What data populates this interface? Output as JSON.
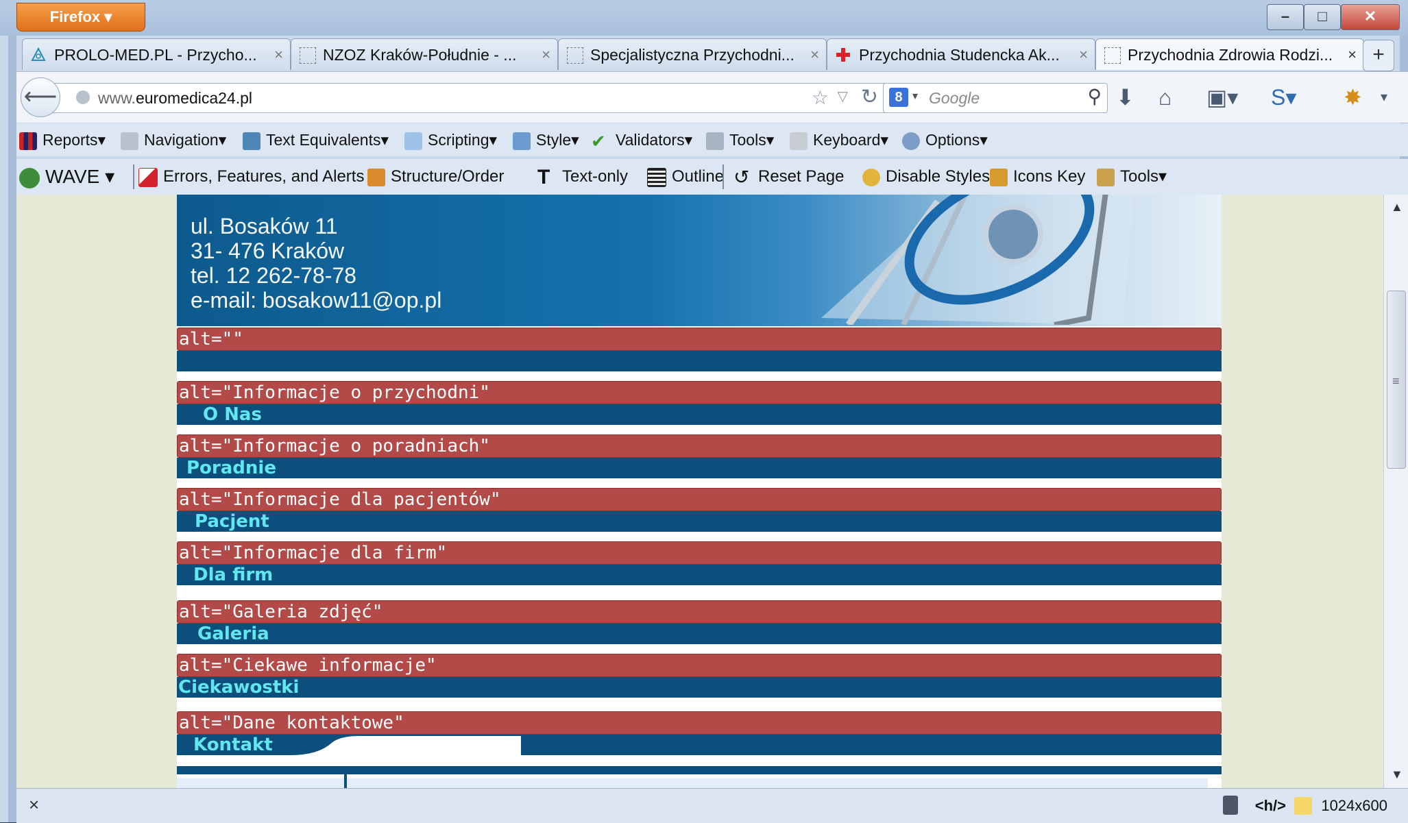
{
  "browser": {
    "app_button": "Firefox ▾",
    "window_controls": [
      "–",
      "□",
      "✕"
    ],
    "tabs": [
      {
        "title": "PROLO-MED.PL - Przycho...",
        "close": "×"
      },
      {
        "title": "NZOZ Kraków-Południe - ...",
        "close": "×"
      },
      {
        "title": "Specjalistyczna Przychodni...",
        "close": "×"
      },
      {
        "title": "Przychodnia Studencka Ak...",
        "close": "×"
      },
      {
        "title": "Przychodnia Zdrowia Rodzi...",
        "close": "×"
      }
    ],
    "new_tab": "+",
    "url_prefix": "www.",
    "url_domain": "euromedica24.pl",
    "search_placeholder": "Google",
    "search_engine_glyph": "8"
  },
  "accessibility_toolbar": {
    "items": [
      "Reports",
      "Navigation",
      "Text Equivalents",
      "Scripting",
      "Style",
      "Validators",
      "Tools",
      "Keyboard",
      "Options"
    ]
  },
  "wave_toolbar": {
    "brand": "WAVE ▾",
    "items": [
      "Errors, Features, and Alerts",
      "Structure/Order",
      "Text-only",
      "Outline",
      "Reset Page",
      "Disable Styles",
      "Icons Key",
      "Tools"
    ]
  },
  "page": {
    "address_lines": [
      "ul. Bosaków 11",
      "31- 476 Kraków",
      "tel. 12 262-78-78",
      "e-mail: bosakow11@op.pl"
    ],
    "menu": [
      {
        "alt": "alt=\"\"",
        "label": ""
      },
      {
        "alt": "alt=\"Informacje o przychodni\"",
        "label": "O Nas"
      },
      {
        "alt": "alt=\"Informacje o poradniach\"",
        "label": "Poradnie"
      },
      {
        "alt": "alt=\"Informacje dla pacjentów\"",
        "label": "Pacjent"
      },
      {
        "alt": "alt=\"Informacje dla firm\"",
        "label": "Dla firm"
      },
      {
        "alt": "alt=\"Galeria zdjęć\"",
        "label": "Galeria"
      },
      {
        "alt": "alt=\"Ciekawe informacje\"",
        "label": "Ciekawostki"
      },
      {
        "alt": "alt=\"Dane kontaktowe\"",
        "label": "Kontakt"
      }
    ]
  },
  "statusbar": {
    "close": "×",
    "h_indicator": "<h/>",
    "resolution": "1024x600"
  },
  "colors": {
    "alt_bar": "#b24a48",
    "nav_bar": "#0c4f7c",
    "nav_text": "#62e6ef",
    "page_bg": "#e5e9d5"
  }
}
